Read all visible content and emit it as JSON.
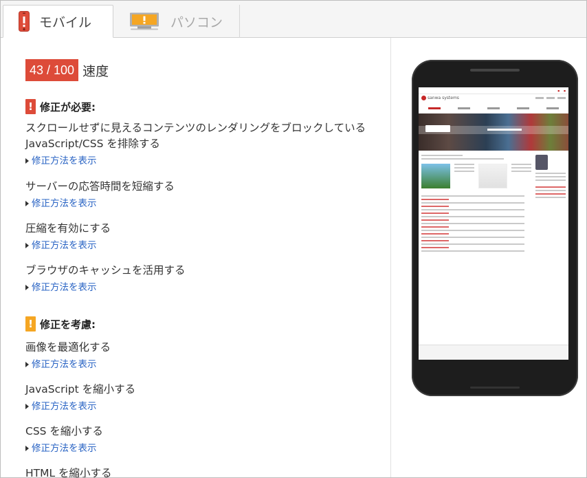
{
  "tabs": [
    {
      "label": "モバイル",
      "icon": "mobile-phone-icon",
      "active": true
    },
    {
      "label": "パソコン",
      "icon": "desktop-monitor-icon",
      "active": false
    }
  ],
  "score": {
    "value": "43 / 100",
    "label": "速度"
  },
  "colors": {
    "score_bg": "#dd4b39",
    "must_fix": "#dd4b39",
    "consider": "#f5a623",
    "link": "#2a64c4"
  },
  "sections": {
    "must_fix": {
      "badge": "!",
      "title": "修正が必要:",
      "rules": [
        {
          "title": "スクロールせずに見えるコンテンツのレンダリングをブロックしている JavaScript/CSS を排除する",
          "link": "修正方法を表示"
        },
        {
          "title": "サーバーの応答時間を短縮する",
          "link": "修正方法を表示"
        },
        {
          "title": "圧縮を有効にする",
          "link": "修正方法を表示"
        },
        {
          "title": "ブラウザのキャッシュを活用する",
          "link": "修正方法を表示"
        }
      ]
    },
    "consider": {
      "badge": "!",
      "title": "修正を考慮:",
      "rules": [
        {
          "title": "画像を最適化する",
          "link": "修正方法を表示"
        },
        {
          "title": "JavaScript を縮小する",
          "link": "修正方法を表示"
        },
        {
          "title": "CSS を縮小する",
          "link": "修正方法を表示"
        },
        {
          "title": "HTML を縮小する",
          "link": ""
        }
      ]
    }
  },
  "preview": {
    "site_logo": "sanwa systems"
  }
}
